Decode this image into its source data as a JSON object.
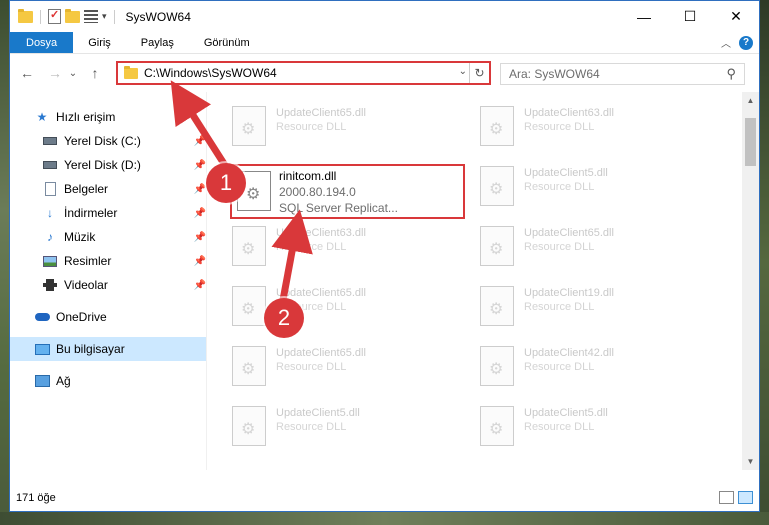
{
  "window": {
    "title": "SysWOW64",
    "controls": {
      "minimize": "—",
      "maximize": "☐",
      "close": "✕"
    }
  },
  "ribbon": {
    "tabs": [
      "Dosya",
      "Giriş",
      "Paylaş",
      "Görünüm"
    ],
    "help": "?",
    "collapse": "︿"
  },
  "navigation": {
    "back": "←",
    "forward": "→",
    "history": "⌄",
    "up": "↑",
    "address": "C:\\Windows\\SysWOW64",
    "address_dropdown": "⌄",
    "refresh": "↻",
    "search_placeholder": "Ara: SysWOW64",
    "search_icon": "⚲"
  },
  "sidebar": {
    "items": [
      {
        "label": "Hızlı erişim",
        "icon": "star-icon"
      },
      {
        "label": "Yerel Disk (C:)",
        "icon": "drive-icon",
        "pinned": true
      },
      {
        "label": "Yerel Disk (D:)",
        "icon": "drive-icon",
        "pinned": true
      },
      {
        "label": "Belgeler",
        "icon": "document-icon",
        "pinned": true
      },
      {
        "label": "İndirmeler",
        "icon": "download-icon",
        "pinned": true
      },
      {
        "label": "Müzik",
        "icon": "music-icon",
        "pinned": true
      },
      {
        "label": "Resimler",
        "icon": "pictures-icon",
        "pinned": true
      },
      {
        "label": "Videolar",
        "icon": "videos-icon",
        "pinned": true
      },
      {
        "label": "OneDrive",
        "icon": "onedrive-icon"
      },
      {
        "label": "Bu bilgisayar",
        "icon": "this-pc-icon",
        "selected": true
      },
      {
        "label": "Ağ",
        "icon": "network-icon"
      }
    ]
  },
  "files": {
    "left_column": [
      {
        "name": "UpdateClient65.dll",
        "type": "Resource DLL"
      },
      {
        "name": "rinitcom.dll",
        "version": "2000.80.194.0",
        "description": "SQL Server Replicat...",
        "highlighted": true
      },
      {
        "name": "UpdateClient63.dll",
        "type": "Resource DLL"
      },
      {
        "name": "UpdateClient65.dll",
        "type": "Resource DLL"
      },
      {
        "name": "UpdateClient65.dll",
        "type": "Resource DLL"
      },
      {
        "name": "UpdateClient5.dll",
        "type": "Resource DLL"
      }
    ],
    "right_column": [
      {
        "name": "UpdateClient63.dll",
        "type": "Resource DLL"
      },
      {
        "name": "UpdateClient5.dll",
        "type": "Resource DLL"
      },
      {
        "name": "UpdateClient65.dll",
        "type": "Resource DLL"
      },
      {
        "name": "UpdateClient19.dll",
        "type": "Resource DLL"
      },
      {
        "name": "UpdateClient42.dll",
        "type": "Resource DLL"
      },
      {
        "name": "UpdateClient5.dll",
        "type": "Resource DLL"
      }
    ]
  },
  "status": {
    "item_count": "171 öğe"
  },
  "annotations": {
    "step1": "1",
    "step2": "2",
    "color": "#d9383a"
  }
}
